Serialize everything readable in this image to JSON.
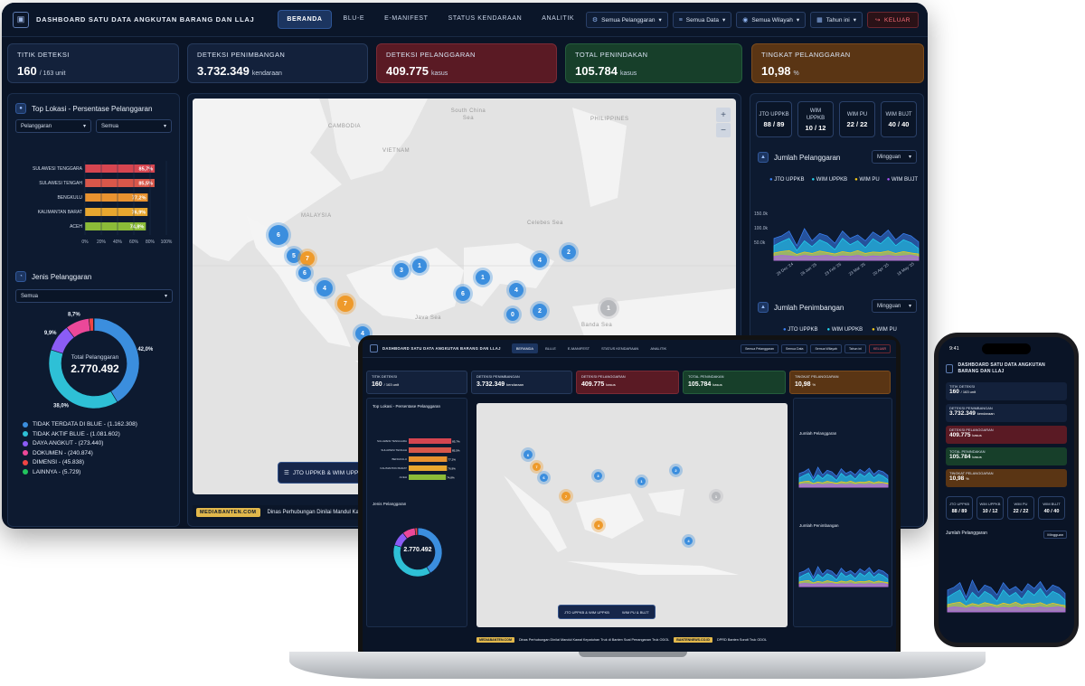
{
  "app": {
    "title": "DASHBOARD SATU DATA ANGKUTAN BARANG DAN LLAJ",
    "nav": [
      "BERANDA",
      "BLU-E",
      "E-MANIFEST",
      "STATUS KENDARAAN",
      "ANALITIK"
    ],
    "active_nav": "BERANDA",
    "filters": [
      "Semua Pelanggaran",
      "Semua Data",
      "Semua Wilayah",
      "Tahun ini"
    ],
    "logout": "KELUAR"
  },
  "kpis": [
    {
      "label": "TITIK DETEKSI",
      "value": "160",
      "unit": "/ 163 unit",
      "color": "#13213b"
    },
    {
      "label": "DETEKSI PENIMBANGAN",
      "value": "3.732.349",
      "unit": "kendaraan",
      "color": "#13213b"
    },
    {
      "label": "DETEKSI PELANGGARAN",
      "value": "409.775",
      "unit": "kasus",
      "color": "#5a1a24"
    },
    {
      "label": "TOTAL PENINDAKAN",
      "value": "105.784",
      "unit": "kasus",
      "color": "#173f2a"
    },
    {
      "label": "TINGKAT PELANGGARAN",
      "value": "10,98",
      "unit": "%",
      "color": "#5a3514"
    }
  ],
  "top_lokasi": {
    "title": "Top Lokasi - Persentase Pelanggaran",
    "select1": "Pelanggaran",
    "select2": "Semua",
    "chart_data": {
      "type": "bar",
      "categories": [
        "SULAWESI TENGGARA",
        "SULAWESI TENGAH",
        "BENGKULU",
        "KALIMANTAN BARAT",
        "ACEH"
      ],
      "values": [
        85.7,
        85.5,
        77.2,
        76.9,
        74.8
      ],
      "value_labels": [
        "85,7%",
        "85,5%",
        "77,2%",
        "76,9%",
        "74,8%"
      ],
      "colors": [
        "#d64550",
        "#d8574a",
        "#e8922f",
        "#e8a72f",
        "#8bbb38"
      ],
      "xticks": [
        "0%",
        "20%",
        "40%",
        "60%",
        "80%",
        "100%"
      ],
      "xlim": [
        0,
        100
      ]
    }
  },
  "jenis_pelanggaran": {
    "title": "Jenis Pelanggaran",
    "select": "Semua",
    "center_label": "Total Pelanggaran",
    "center_value": "2.770.492",
    "chart_data": {
      "type": "pie",
      "labels": [
        "TIDAK TERDATA DI BLUE",
        "TIDAK AKTIF BLUE",
        "DAYA ANGKUT",
        "DOKUMEN",
        "DIMENSI",
        "LAINNYA"
      ],
      "values": [
        1162308,
        1081602,
        273440,
        240874,
        45838,
        5729
      ],
      "slice_labels": [
        "42,0%",
        "38,0%",
        "9,9%",
        "8,7%",
        "",
        ""
      ],
      "colors": [
        "#3b8ede",
        "#2ec0d6",
        "#8b5cf6",
        "#ec4899",
        "#ef4444",
        "#22c55e"
      ]
    },
    "legend": [
      "TIDAK TERDATA DI BLUE - (1.162.308)",
      "TIDAK AKTIF BLUE - (1.081.602)",
      "DAYA ANGKUT - (273.440)",
      "DOKUMEN - (240.874)",
      "DIMENSI - (45.838)",
      "LAINNYA - (5.729)"
    ]
  },
  "map": {
    "labels": [
      "CAMBODIA",
      "VIETNAM",
      "South China Sea",
      "MALAYSIA",
      "Celebes Sea",
      "Java Sea",
      "Banda Sea",
      "PHILIPPINES"
    ],
    "clusters": [
      {
        "n": "6",
        "c": "b"
      },
      {
        "n": "5",
        "c": "b"
      },
      {
        "n": "7",
        "c": "o"
      },
      {
        "n": "6",
        "c": "b"
      },
      {
        "n": "4",
        "c": "o"
      },
      {
        "n": "7",
        "c": "o"
      },
      {
        "n": "3",
        "c": "b"
      },
      {
        "n": "1",
        "c": "b"
      },
      {
        "n": "1",
        "c": "b"
      },
      {
        "n": "6",
        "c": "b"
      },
      {
        "n": "4",
        "c": "b"
      },
      {
        "n": "2",
        "c": "b"
      },
      {
        "n": "4",
        "c": "b"
      },
      {
        "n": "0",
        "c": "b"
      },
      {
        "n": "2",
        "c": "b"
      },
      {
        "n": "1",
        "c": "g"
      },
      {
        "n": "4",
        "c": "b"
      }
    ],
    "overlay_button": "JTO UPPKB & WIM UPPKB",
    "ticker_source": "MEDIABANTEN.COM",
    "ticker_text": "Dinas Perhubungan Dinilai Mandul Kawal Kepu"
  },
  "units": [
    {
      "name": "JTO UPPKB",
      "value": "88 / 89"
    },
    {
      "name": "WIM UPPKB",
      "value": "10 / 12"
    },
    {
      "name": "WIM PU",
      "value": "22 / 22"
    },
    {
      "name": "WIM BUJT",
      "value": "40 / 40"
    }
  ],
  "jumlah_pelanggaran": {
    "title": "Jumlah Pelanggaran",
    "select": "Mingguan",
    "chart_data": {
      "type": "area",
      "series": [
        {
          "name": "JTO UPPKB",
          "color": "#3b82f6"
        },
        {
          "name": "WIM UPPKB",
          "color": "#22d3ee"
        },
        {
          "name": "WIM PU",
          "color": "#facc15"
        },
        {
          "name": "WIM BUJT",
          "color": "#a855f7"
        }
      ],
      "yticks": [
        "150.0k",
        "100.0k",
        "50.0k"
      ],
      "xticks": [
        "29 Dec '24",
        "26 Jan '25",
        "23 Feb '25",
        "23 Mar '25",
        "20 Apr '25",
        "18 May '25",
        "15 Jun '25",
        "20 Jul '25",
        "17 Aug '25",
        "21 Sep '25",
        "19 Oct '25",
        "23 Nov '25"
      ]
    }
  },
  "jumlah_penimbangan": {
    "title": "Jumlah Penimbangan",
    "select": "Mingguan",
    "legend": [
      "JTO UPPKB",
      "WIM UPPKB",
      "WIM PU"
    ]
  },
  "laptop": {
    "ticker_source": "MEDIABANTEN.COM",
    "ticker_text": "Dinas Perhubungan Dinilai Mandul Kawal Kepatuhan Truk di Banten Soal Penanganan Truk ODOL",
    "ticker_source2": "BANTENNEWS.CO.ID",
    "ticker_text2": "DPRD Banten Soroti Truk ODOL",
    "button1": "JTO UPPKB & WIM UPPKB",
    "button2": "WIM PU & BUJT"
  },
  "phone": {
    "time": "9:41",
    "title": "DASHBOARD SATU DATA ANGKUTAN BARANG DAN LLAJ"
  }
}
